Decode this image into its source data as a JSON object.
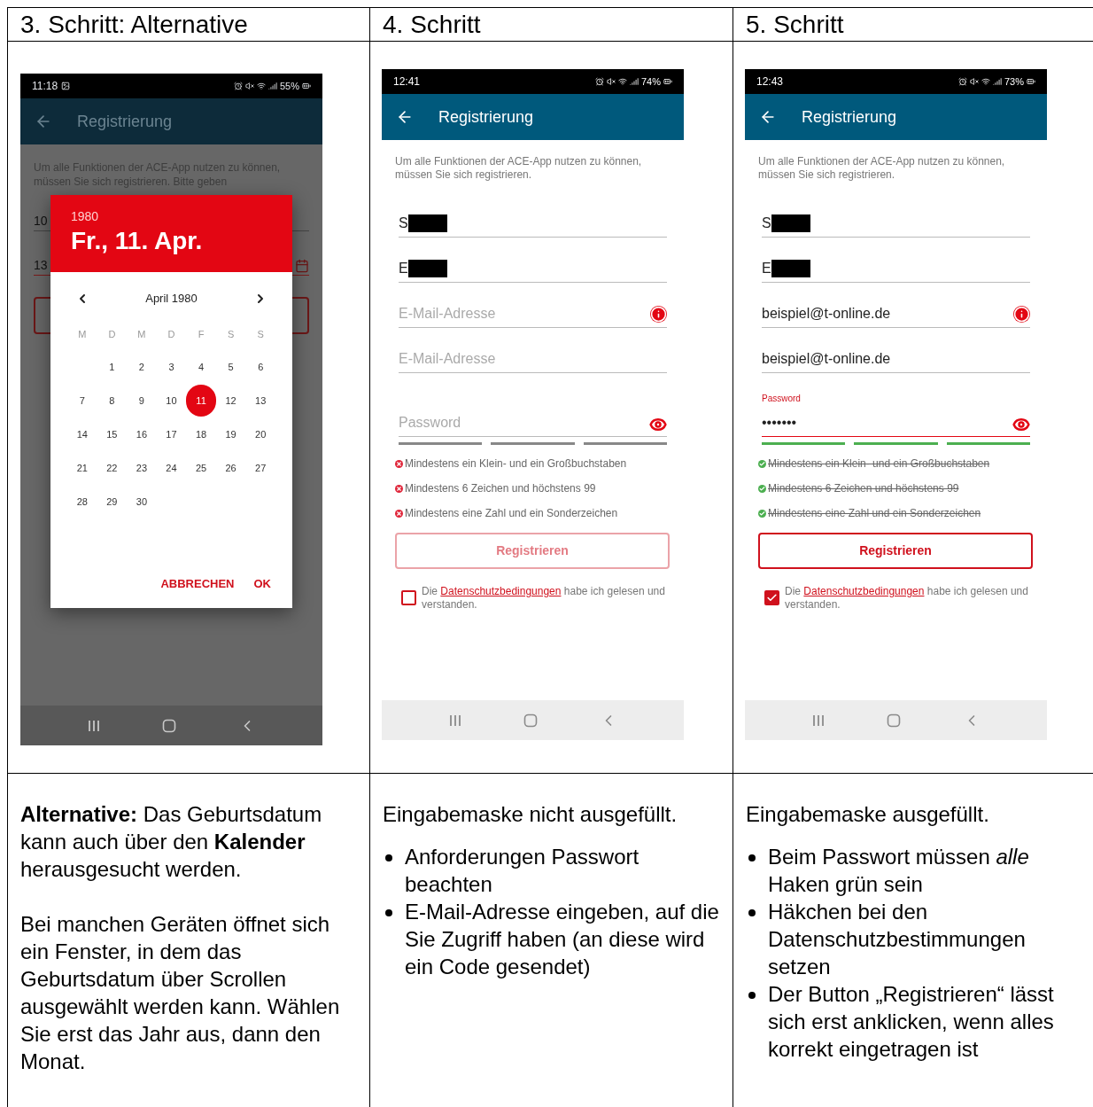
{
  "columns": [
    {
      "heading": "3. Schritt: Alternative",
      "phone": {
        "kind": "date_picker",
        "status_bar": {
          "time": "11:18",
          "photo_notification": true,
          "battery": "55%"
        },
        "app_bar": {
          "title": "Registrierung"
        },
        "intro": "Um alle Funktionen der ACE-App nutzen zu können, müssen Sie sich registrieren. Bitte geben",
        "fields": [
          {
            "value": "10",
            "error": false
          },
          {
            "value": "13",
            "error": true
          }
        ],
        "dialog": {
          "year": "1980",
          "date": "Fr., 11. Apr.",
          "month": "April 1980",
          "weekdays": [
            "M",
            "D",
            "M",
            "D",
            "F",
            "S",
            "S"
          ],
          "weeks": [
            [
              {
                "label": "1",
                "selected": false
              },
              {
                "label": "2",
                "selected": false
              },
              {
                "label": "3",
                "selected": false
              },
              {
                "label": "4",
                "selected": false
              },
              {
                "label": "5",
                "selected": false
              },
              {
                "label": "6",
                "selected": false
              }
            ],
            [
              {
                "label": "7",
                "selected": false
              },
              {
                "label": "8",
                "selected": false
              },
              {
                "label": "9",
                "selected": false
              },
              {
                "label": "10",
                "selected": false
              },
              {
                "label": "11",
                "selected": true
              },
              {
                "label": "12",
                "selected": false
              },
              {
                "label": "13",
                "selected": false
              }
            ],
            [
              {
                "label": "14",
                "selected": false
              },
              {
                "label": "15",
                "selected": false
              },
              {
                "label": "16",
                "selected": false
              },
              {
                "label": "17",
                "selected": false
              },
              {
                "label": "18",
                "selected": false
              },
              {
                "label": "19",
                "selected": false
              },
              {
                "label": "20",
                "selected": false
              }
            ],
            [
              {
                "label": "21",
                "selected": false
              },
              {
                "label": "22",
                "selected": false
              },
              {
                "label": "23",
                "selected": false
              },
              {
                "label": "24",
                "selected": false
              },
              {
                "label": "25",
                "selected": false
              },
              {
                "label": "26",
                "selected": false
              },
              {
                "label": "27",
                "selected": false
              }
            ],
            [
              {
                "label": "28",
                "selected": false
              },
              {
                "label": "29",
                "selected": false
              },
              {
                "label": "30",
                "selected": false
              }
            ]
          ],
          "actions": [
            "ABBRECHEN",
            "OK"
          ]
        }
      },
      "description": {
        "paragraphs": [
          "**Alternative:** Das Geburtsdatum kann auch über den **Kalender** herausgesucht werden.",
          "Bei manchen Geräten öffnet sich ein Fenster, in dem das Geburtsdatum über Scrollen ausgewählt werden kann. Wählen Sie erst das Jahr aus, dann den Monat."
        ]
      }
    },
    {
      "heading": "4. Schritt",
      "phone": {
        "kind": "form",
        "status_bar": {
          "time": "12:41",
          "photo_notification": false,
          "battery": "74%"
        },
        "app_bar": {
          "title": "Registrierung"
        },
        "intro": "Um alle Funktionen der ACE-App nutzen zu können, müssen Sie sich registrieren.",
        "fields": [
          {
            "value": "S",
            "redacted": true,
            "error": false
          },
          {
            "value": "E",
            "redacted": true,
            "error": false
          },
          {
            "placeholder": "E-Mail-Adresse",
            "error": true
          },
          {
            "placeholder": "E-Mail-Adresse",
            "error": false
          }
        ],
        "password": {
          "placeholder": "Password",
          "focused": false
        },
        "strength": [
          {
            "met": false
          },
          {
            "met": false
          },
          {
            "met": false
          }
        ],
        "requirements": [
          {
            "text": "Mindestens ein Klein- und ein Großbuchstaben",
            "met": false
          },
          {
            "text": "Mindestens 6 Zeichen und höchstens 99",
            "met": false
          },
          {
            "text": "Mindestens eine Zahl und ein Sonderzeichen",
            "met": false
          }
        ],
        "button": {
          "label": "Registrieren",
          "disabled": true
        },
        "consent": {
          "checked": false,
          "before": "Die",
          "link": "Datenschutzbedingungen",
          "after": "habe ich gelesen und verstanden."
        }
      },
      "description": {
        "paragraphs": [
          "Eingabemaske nicht ausgefüllt."
        ],
        "bullets": [
          "Anforderungen Passwort beachten",
          "E-Mail-Adresse eingeben, auf die Sie Zugriff haben (an diese wird ein Code gesendet)"
        ]
      }
    },
    {
      "heading": "5. Schritt",
      "phone": {
        "kind": "form",
        "status_bar": {
          "time": "12:43",
          "photo_notification": false,
          "battery": "73%"
        },
        "app_bar": {
          "title": "Registrierung"
        },
        "intro": "Um alle Funktionen der ACE-App nutzen zu können, müssen Sie sich registrieren.",
        "fields": [
          {
            "value": "S",
            "redacted": true,
            "error": false
          },
          {
            "value": "E",
            "redacted": true,
            "error": false
          },
          {
            "value": "beispiel@t-online.de",
            "error": true
          },
          {
            "value": "beispiel@t-online.de",
            "error": false
          }
        ],
        "password": {
          "label": "Password",
          "value": "•••••••",
          "focused": true
        },
        "strength": [
          {
            "met": true
          },
          {
            "met": true
          },
          {
            "met": true
          }
        ],
        "requirements": [
          {
            "text": "Mindestens ein Klein- und ein Großbuchstaben",
            "met": true
          },
          {
            "text": "Mindestens 6 Zeichen und höchstens 99",
            "met": true
          },
          {
            "text": "Mindestens eine Zahl und ein Sonderzeichen",
            "met": true
          }
        ],
        "button": {
          "label": "Registrieren",
          "disabled": false
        },
        "consent": {
          "checked": true,
          "before": "Die",
          "link": "Datenschutzbedingungen",
          "after": "habe ich gelesen und verstanden."
        }
      },
      "description": {
        "paragraphs": [
          "Eingabemaske ausgefüllt."
        ],
        "bullets": [
          "Beim Passwort müssen *alle* Haken grün sein",
          "Häkchen bei den Datenschutzbestimmungen setzen",
          "Der Button „Registrieren“ lässt sich erst anklicken, wenn alles korrekt eingetragen ist"
        ]
      }
    }
  ]
}
